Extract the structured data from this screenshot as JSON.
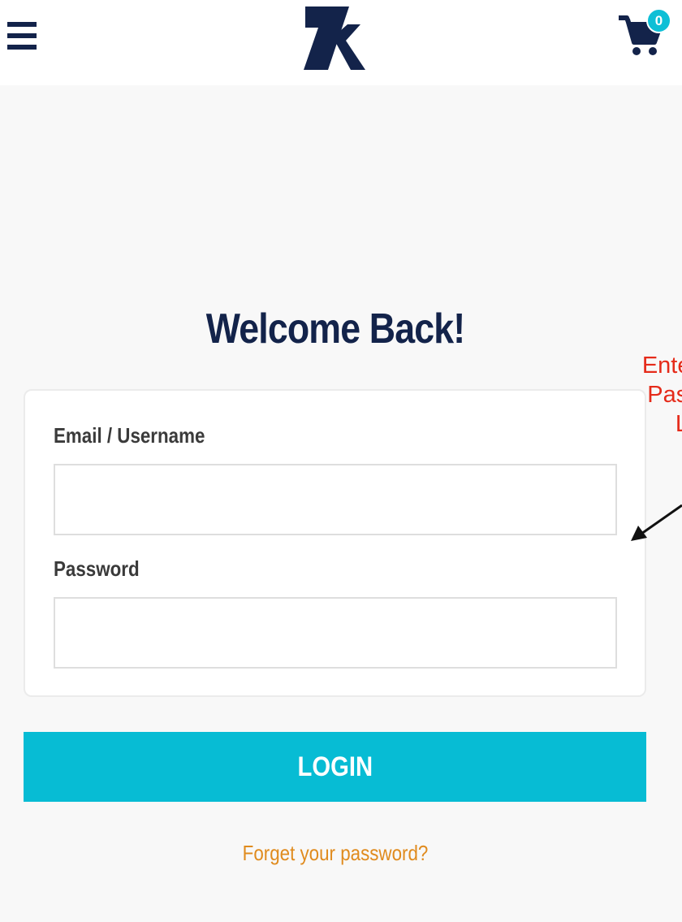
{
  "header": {
    "menu_icon": "hamburger-menu-icon",
    "logo_icon": "7k-logo",
    "cart_icon": "shopping-cart-icon",
    "cart_count": "0"
  },
  "main": {
    "title": "Welcome Back!",
    "email_label": "Email / Username",
    "email_value": "",
    "password_label": "Password",
    "password_value": "",
    "login_label": "LOGIN",
    "forgot_label": "Forget your password?"
  },
  "annotation": {
    "text": "Enter U\nPassw\nL"
  },
  "colors": {
    "navy": "#13234a",
    "accent": "#07bcd4",
    "link": "#e08b1e",
    "annotation": "#e52b1a",
    "background": "#f8f8f8"
  }
}
